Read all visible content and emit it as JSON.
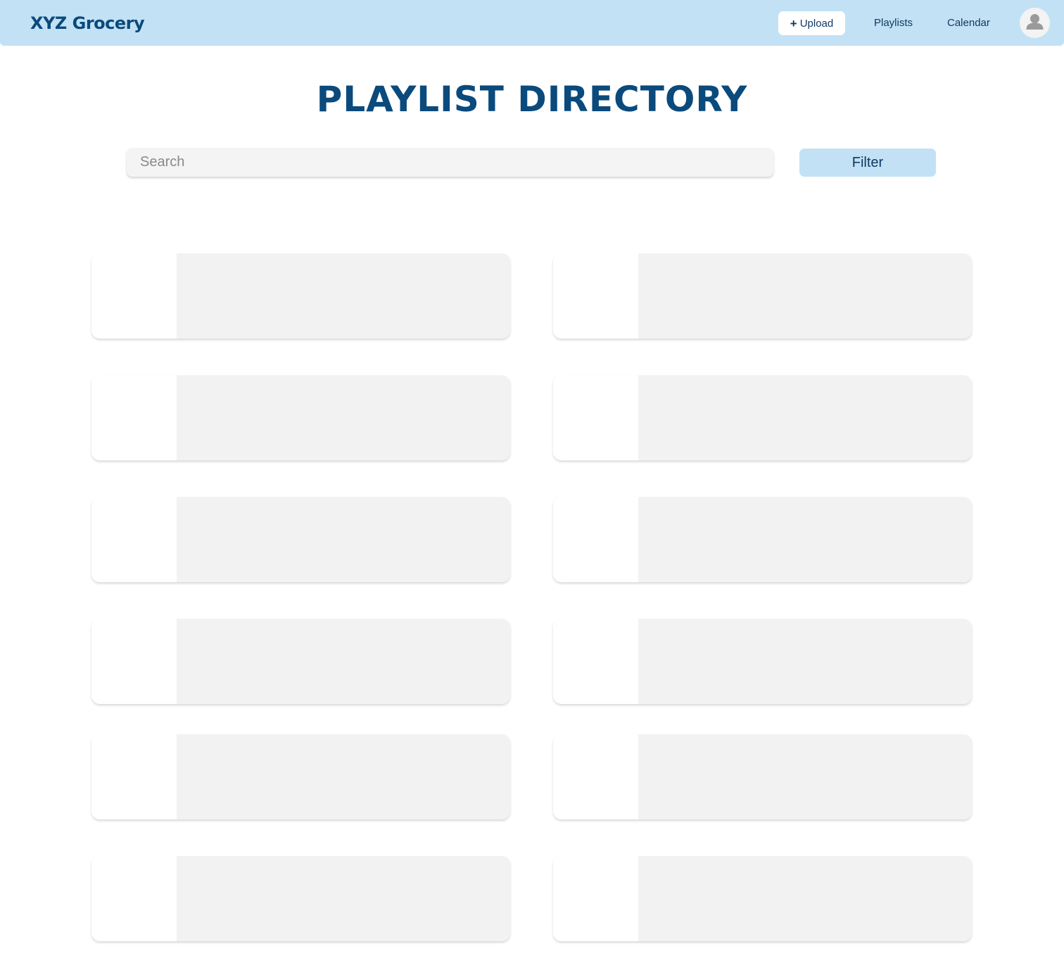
{
  "header": {
    "brand": "XYZ Grocery",
    "upload_icon": "plus-icon",
    "upload_label": "Upload",
    "nav": [
      "Playlists",
      "Calendar"
    ],
    "avatar_icon": "user-avatar-icon"
  },
  "page": {
    "title": "PLAYLIST DIRECTORY"
  },
  "search": {
    "placeholder": "Search",
    "value": ""
  },
  "filter": {
    "label": "Filter"
  },
  "playlists": {
    "count": 12,
    "columns": 2
  },
  "colors": {
    "header_bg": "#c3e1f5",
    "brand_text": "#0a4a7c",
    "card_body": "#f2f2f2"
  }
}
